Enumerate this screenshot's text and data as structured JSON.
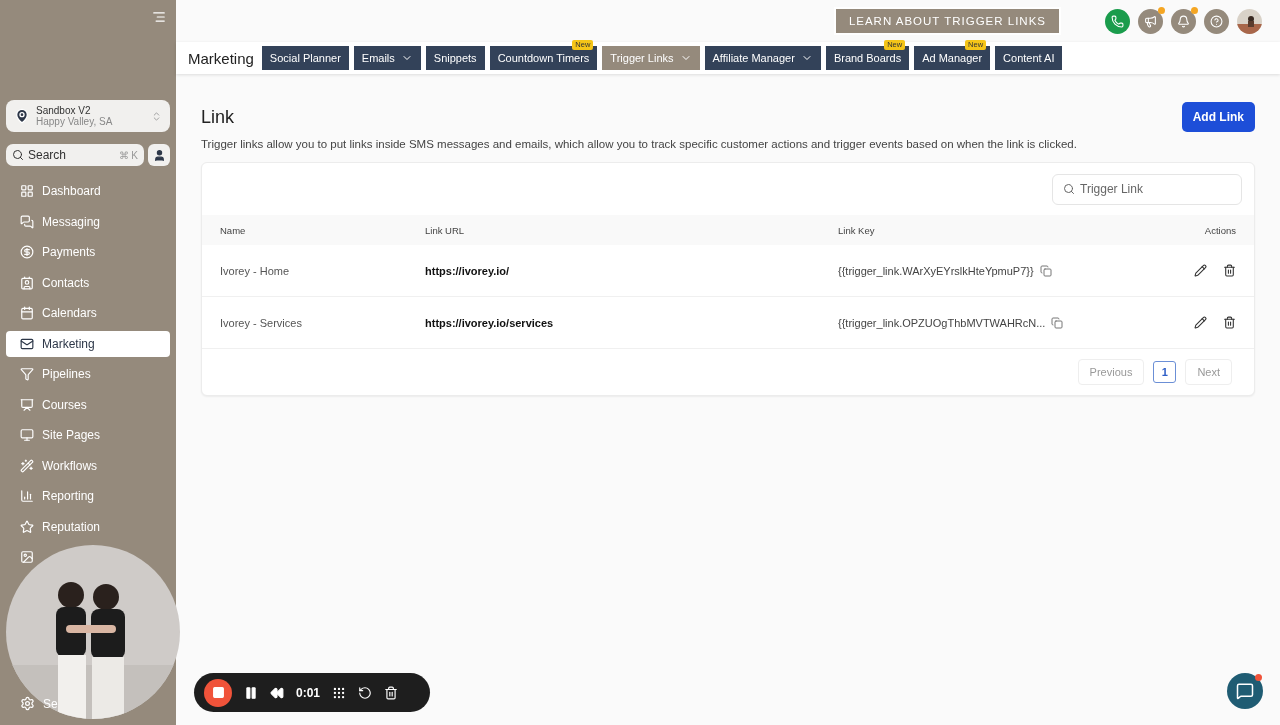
{
  "sidebar": {
    "account": {
      "name": "Sandbox V2",
      "location": "Happy Valley, SA"
    },
    "search": {
      "placeholder": "Search",
      "shortcut": "⌘ K"
    },
    "items": [
      {
        "label": "Dashboard",
        "selected": false
      },
      {
        "label": "Messaging",
        "selected": false
      },
      {
        "label": "Payments",
        "selected": false
      },
      {
        "label": "Contacts",
        "selected": false
      },
      {
        "label": "Calendars",
        "selected": false
      },
      {
        "label": "Marketing",
        "selected": true
      },
      {
        "label": "Pipelines",
        "selected": false
      },
      {
        "label": "Courses",
        "selected": false
      },
      {
        "label": "Site Pages",
        "selected": false
      },
      {
        "label": "Workflows",
        "selected": false
      },
      {
        "label": "Reporting",
        "selected": false
      },
      {
        "label": "Reputation",
        "selected": false
      },
      {
        "selected": false
      }
    ],
    "footer": {
      "label": "Se"
    }
  },
  "topbar": {
    "learn_button": "LEARN ABOUT TRIGGER LINKS",
    "icons": [
      {
        "dot": false
      },
      {
        "dot": true
      },
      {
        "dot": true
      },
      {
        "dot": false
      }
    ]
  },
  "section": "Marketing",
  "tabs": [
    {
      "label": "Social Planner",
      "selected": false,
      "dropdown": false
    },
    {
      "label": "Emails",
      "selected": false,
      "dropdown": true
    },
    {
      "label": "Snippets",
      "selected": false,
      "dropdown": false
    },
    {
      "label": "Countdown Timers",
      "selected": false,
      "dropdown": false,
      "badge": "New"
    },
    {
      "label": "Trigger Links",
      "selected": true,
      "dropdown": true
    },
    {
      "label": "Affiliate Manager",
      "selected": false,
      "dropdown": true
    },
    {
      "label": "Brand Boards",
      "selected": false,
      "dropdown": false,
      "badge": "New"
    },
    {
      "label": "Ad Manager",
      "selected": false,
      "dropdown": false,
      "badge": "New"
    },
    {
      "label": "Content AI",
      "selected": false,
      "dropdown": false
    }
  ],
  "page": {
    "title": "Link",
    "add_button": "Add Link",
    "description": "Trigger links allow you to put links inside SMS messages and emails, which allow you to track specific customer actions and trigger events based on when the link is clicked."
  },
  "table": {
    "search": {
      "placeholder": "Trigger Link"
    },
    "columns": [
      "Name",
      "Link URL",
      "Link Key",
      "Actions"
    ],
    "rows": [
      {
        "name": "Ivorey - Home",
        "url": "https://ivorey.io/",
        "key": "{{trigger_link.WArXyEYrslkHteYpmuP7}}"
      },
      {
        "name": "Ivorey - Services",
        "url": "https://ivorey.io/services",
        "key": "{{trigger_link.OPZUOgThbMVTWAHRcN..."
      }
    ],
    "pagination": {
      "previous": "Previous",
      "pages": [
        {
          "label": "1",
          "selected": true
        }
      ],
      "next": "Next"
    }
  },
  "recorder": {
    "time": "0:01"
  }
}
